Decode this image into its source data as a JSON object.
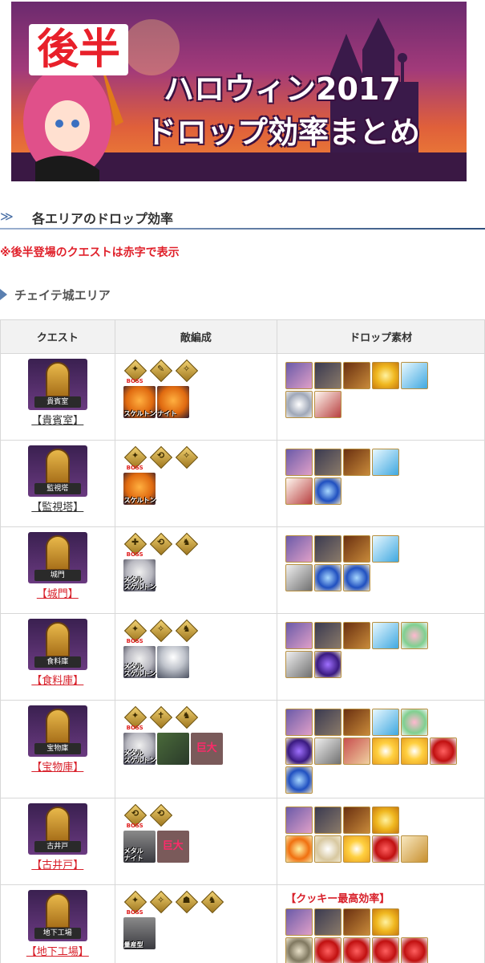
{
  "banner": {
    "badge": "後半",
    "title_line1": "ハロウィン2017",
    "title_line2": "ドロップ効率まとめ"
  },
  "section": {
    "arrows": "≫",
    "heading": "各エリアのドロップ効率"
  },
  "note": "※後半登場のクエストは赤字で表示",
  "subsection": {
    "heading": "チェイテ城エリア"
  },
  "table": {
    "headers": [
      "クエスト",
      "敵編成",
      "ドロップ素材"
    ],
    "rows": [
      {
        "plate": "貴賓室",
        "link": "【貴賓室】",
        "late": false,
        "classes": [
          "✦",
          "✎",
          "✧"
        ],
        "boss_index": 0,
        "mobs": [
          {
            "type": "pump",
            "label": "スケルトン"
          },
          {
            "type": "pump",
            "label": "ナイト"
          }
        ],
        "drops": [
          [
            "m-card",
            "m-man",
            "m-bull",
            "m-bolt",
            "m-drill"
          ],
          [
            "m-crys",
            "m-bone"
          ]
        ]
      },
      {
        "plate": "監視塔",
        "link": "【監視塔】",
        "late": false,
        "classes": [
          "✦",
          "⟲",
          "✧"
        ],
        "boss_index": 0,
        "mobs": [
          {
            "type": "pump",
            "label": "スケルトン"
          }
        ],
        "drops": [
          [
            "m-card",
            "m-man",
            "m-bull",
            "m-drill"
          ],
          [
            "m-bone",
            "m-orb"
          ]
        ]
      },
      {
        "plate": "城門",
        "link": "【城門】",
        "late": true,
        "classes": [
          "✚",
          "⟲",
          "♞"
        ],
        "boss_index": 0,
        "mobs": [
          {
            "type": "skel",
            "label": "メタル\nスケルトン"
          }
        ],
        "drops": [
          [
            "m-card",
            "m-man",
            "m-bull",
            "m-drill"
          ],
          [
            "m-fang",
            "m-orb",
            "m-orb"
          ]
        ]
      },
      {
        "plate": "食料庫",
        "link": "【食料庫】",
        "late": true,
        "classes": [
          "✦",
          "✧",
          "♞"
        ],
        "boss_index": 0,
        "mobs": [
          {
            "type": "skel",
            "label": "メタル\nスケルトン"
          },
          {
            "type": "ghost",
            "label": ""
          }
        ],
        "drops": [
          [
            "m-card",
            "m-man",
            "m-bull",
            "m-drill",
            "m-heart"
          ],
          [
            "m-fang",
            "m-gem"
          ]
        ]
      },
      {
        "plate": "宝物庫",
        "link": "【宝物庫】",
        "late": true,
        "classes": [
          "✦",
          "✝",
          "♞"
        ],
        "boss_index": 0,
        "mobs": [
          {
            "type": "skel",
            "label": "メタル\nスケルトン"
          },
          {
            "type": "green",
            "label": ""
          }
        ],
        "giant": "巨大",
        "drops": [
          [
            "m-card",
            "m-man",
            "m-bull",
            "m-drill",
            "m-heart"
          ],
          [
            "m-gem",
            "m-fang",
            "m-chain",
            "m-sun",
            "m-sun",
            "m-red"
          ],
          [
            "m-orb"
          ]
        ]
      },
      {
        "plate": "古井戸",
        "link": "【古井戸】",
        "late": true,
        "classes": [
          "⟲",
          "⟲"
        ],
        "boss_index": 0,
        "mobs": [
          {
            "type": "robo",
            "label": "メタル\nナイト"
          }
        ],
        "giant": "巨大",
        "drops": [
          [
            "m-card",
            "m-man",
            "m-bull",
            "m-bolt"
          ],
          [
            "m-fire",
            "m-bell",
            "m-sun",
            "m-red",
            "m-bird"
          ]
        ]
      },
      {
        "plate": "地下工場",
        "link": "【地下工場】",
        "late": true,
        "classes": [
          "✦",
          "✧",
          "☗",
          "♞"
        ],
        "boss_index": 0,
        "mobs": [
          {
            "type": "robo",
            "label": "量産型"
          }
        ],
        "cookie": "【クッキー最高効率】",
        "drops": [
          [
            "m-card",
            "m-man",
            "m-bull",
            "m-bolt"
          ],
          [
            "m-ring",
            "m-red",
            "m-red",
            "m-red",
            "m-red"
          ]
        ]
      }
    ]
  },
  "boss_label": "BOSS"
}
